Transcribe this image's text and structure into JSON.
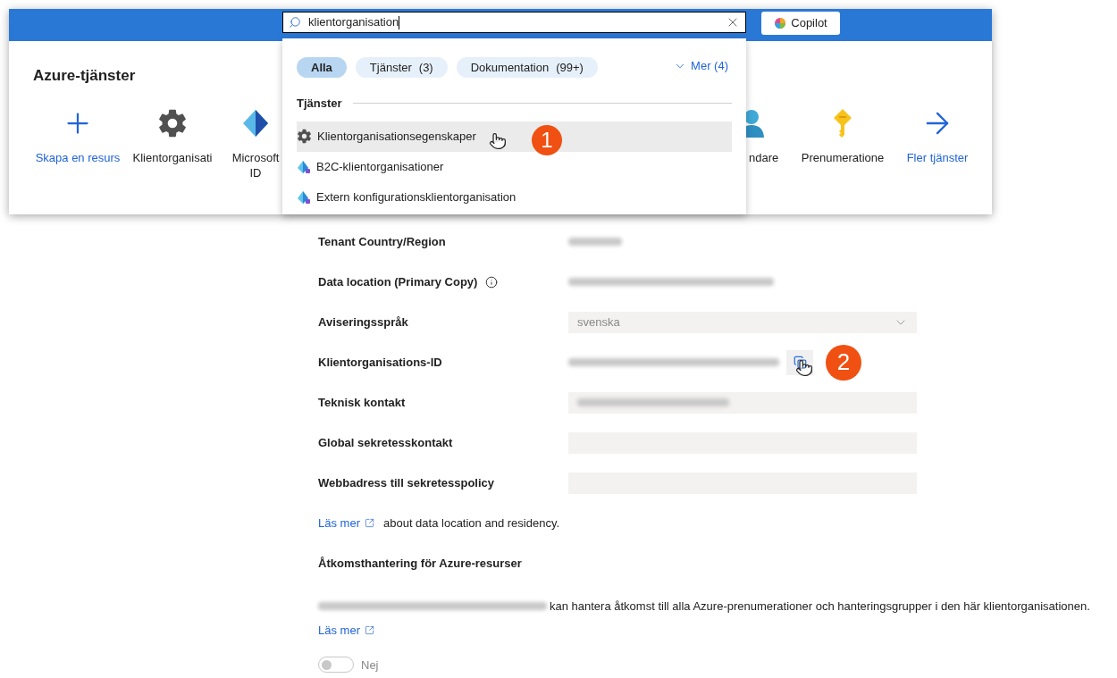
{
  "header": {
    "search": {
      "value": "klientorganisation"
    },
    "copilot_button": "Copilot"
  },
  "services": {
    "title": "Azure-tjänster",
    "items": [
      {
        "kind": "create",
        "label": "Skapa en resurs"
      },
      {
        "kind": "gear",
        "label": "Klientorganisati"
      },
      {
        "kind": "entra",
        "label": "Microsoft ID"
      },
      {
        "kind": "user",
        "label": "ndare"
      },
      {
        "kind": "key",
        "label": "Prenumeratione"
      },
      {
        "kind": "more",
        "label": "Fler tjänster"
      }
    ]
  },
  "search_dropdown": {
    "filters": [
      {
        "label": "Alla",
        "selected": true
      },
      {
        "label": "Tjänster",
        "count": "(3)",
        "selected": false
      },
      {
        "label": "Dokumentation",
        "count": "(99+)",
        "selected": false
      }
    ],
    "more": "Mer (4)",
    "section": "Tjänster",
    "results": [
      {
        "kind": "gear",
        "label": "Klientorganisationsegenskaper",
        "selected": true
      },
      {
        "kind": "pyramid",
        "label": "B2C-klientorganisationer",
        "selected": false
      },
      {
        "kind": "pyramid",
        "label": "Extern konfigurationsklientorganisation",
        "selected": false
      }
    ]
  },
  "properties": [
    {
      "label": "Tenant Country/Region",
      "kind": "blurred",
      "info": false
    },
    {
      "label": "Data location (Primary Copy)",
      "kind": "blurred",
      "info": true
    },
    {
      "label": "Aviseringsspråk",
      "kind": "select",
      "value": "svenska",
      "info": false
    },
    {
      "label": "Klientorganisations-ID",
      "kind": "copy",
      "info": false
    },
    {
      "label": "Teknisk kontakt",
      "kind": "input_blurred",
      "info": false
    },
    {
      "label": "Global sekretesskontakt",
      "kind": "input",
      "info": false
    },
    {
      "label": "Webbadress till sekretesspolicy",
      "kind": "input",
      "info": false
    }
  ],
  "data_location_note": {
    "link": "Läs mer",
    "text": "about data location and residency."
  },
  "access": {
    "title": "Åtkomsthantering för Azure-resurser",
    "text": "kan hantera åtkomst till alla Azure-prenumerationer och hanteringsgrupper i den här klientorganisationen.",
    "link": "Läs mer",
    "toggle": {
      "on": false,
      "label": "Nej"
    }
  },
  "annotations": [
    "1",
    "2"
  ]
}
